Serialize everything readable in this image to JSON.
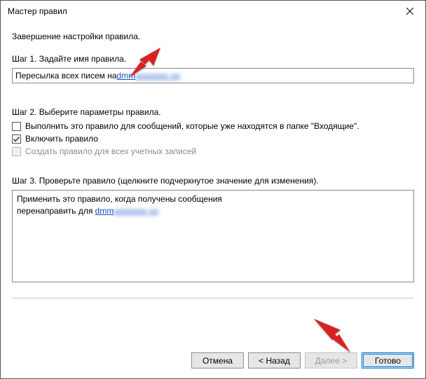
{
  "titlebar": {
    "title": "Мастер правил"
  },
  "heading": "Завершение настройки правила.",
  "step1": {
    "label": "Шаг 1. Задайте имя правила.",
    "prefix": "Пересылка всех писем на ",
    "link_visible": "dmm",
    "link_blurred": "aaaaaaa aa"
  },
  "step2": {
    "label": "Шаг 2. Выберите параметры правила.",
    "opt1": {
      "label": "Выполнить это правило для сообщений, которые уже находятся в папке \"Входящие\"."
    },
    "opt2": {
      "label": "Включить правило"
    },
    "opt3": {
      "label": "Создать правило для всех учетных записей"
    }
  },
  "step3": {
    "label": "Шаг 3. Проверьте правило (щелкните подчеркнутое значение для изменения).",
    "line1": "Применить это правило, когда получены сообщения",
    "line2_prefix": "перенаправить для ",
    "link_visible": "dmm",
    "link_blurred": "aaaaaaa aa"
  },
  "buttons": {
    "cancel": "Отмена",
    "back": "< Назад",
    "next": "Далее >",
    "finish": "Готово"
  }
}
